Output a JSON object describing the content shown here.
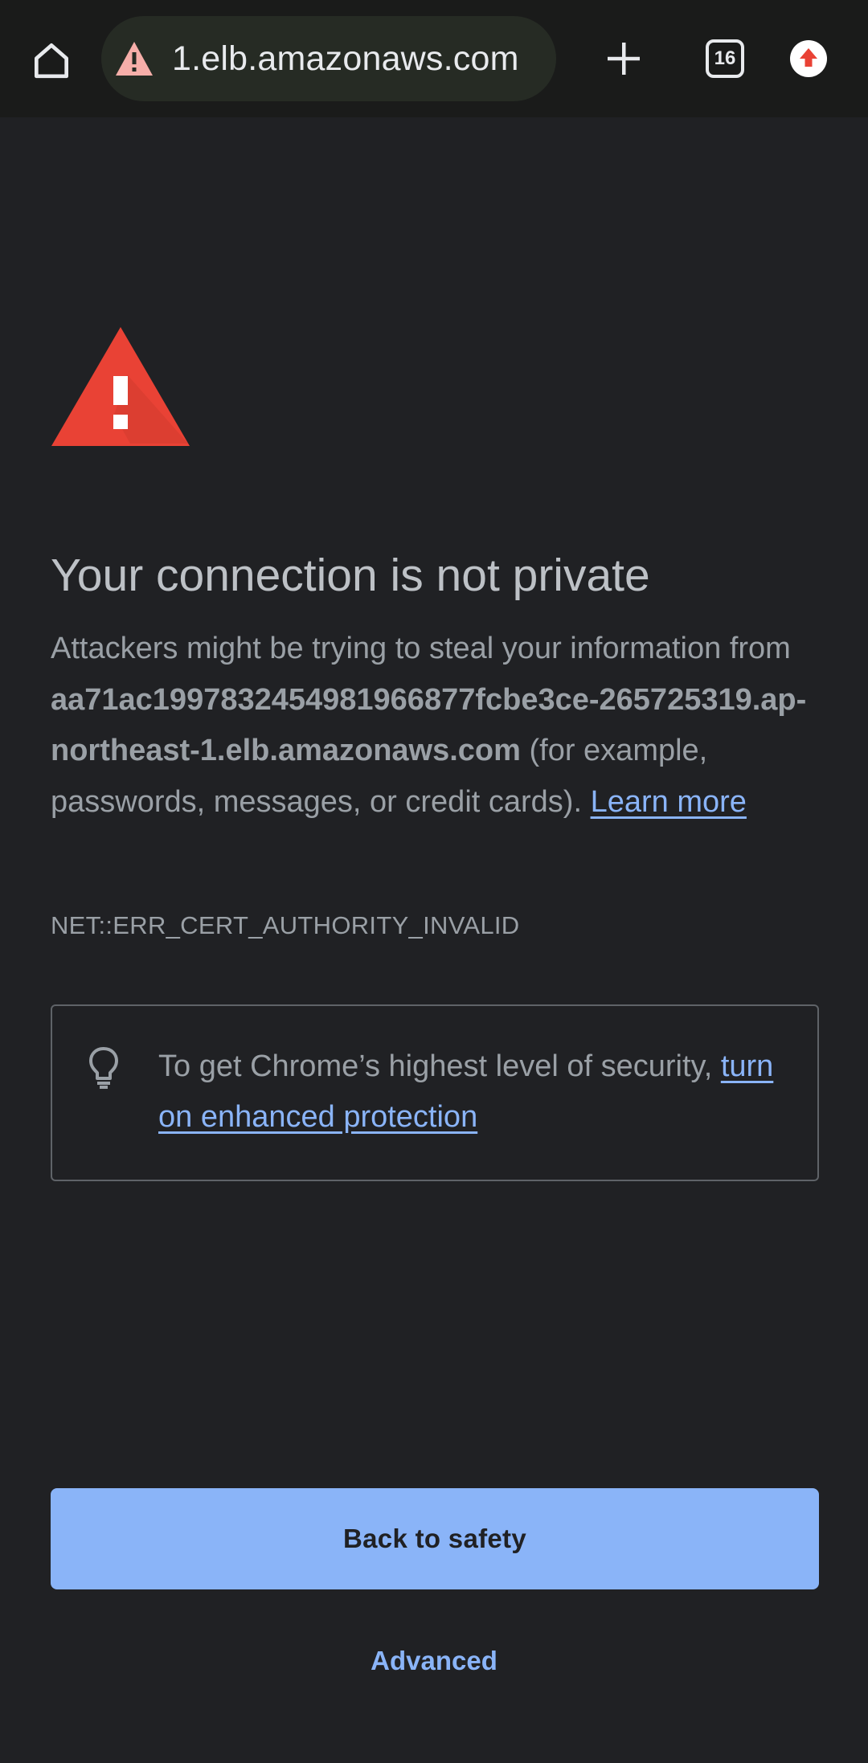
{
  "toolbar": {
    "url_text": "1.elb.amazonaws.com",
    "tab_count": "16",
    "icons": {
      "home": "home-icon",
      "security_warning": "warning-triangle-icon",
      "new_tab": "plus-icon",
      "tab_switcher": "tab-switcher-icon",
      "update": "update-arrow-icon"
    }
  },
  "interstitial": {
    "icon": "red-alert-triangle-icon",
    "headline": "Your connection is not private",
    "body_intro": "Attackers might be trying to steal your information from ",
    "host": "aa71ac19978324549819668​77fcbe3ce-265725319.ap-northeast-1.elb.amazonaws.com",
    "body_outro": " (for example, passwords, messages, or credit cards). ",
    "learn_more": "Learn more",
    "error_code": "NET::ERR_CERT_AUTHORITY_INVALID",
    "enhanced_icon": "lightbulb-icon",
    "enhanced_text": "To get Chrome’s highest level of security, ",
    "enhanced_link": "turn on enhanced protection",
    "primary_button": "Back to safety",
    "advanced_button": "Advanced"
  },
  "colors": {
    "background": "#202124",
    "toolbar": "#1a1b1a",
    "omnibox": "#262b24",
    "accent_blue": "#8ab4f8",
    "alert_red": "#e94235",
    "text_primary": "#bdc1c6",
    "text_secondary": "#9aa0a6"
  }
}
